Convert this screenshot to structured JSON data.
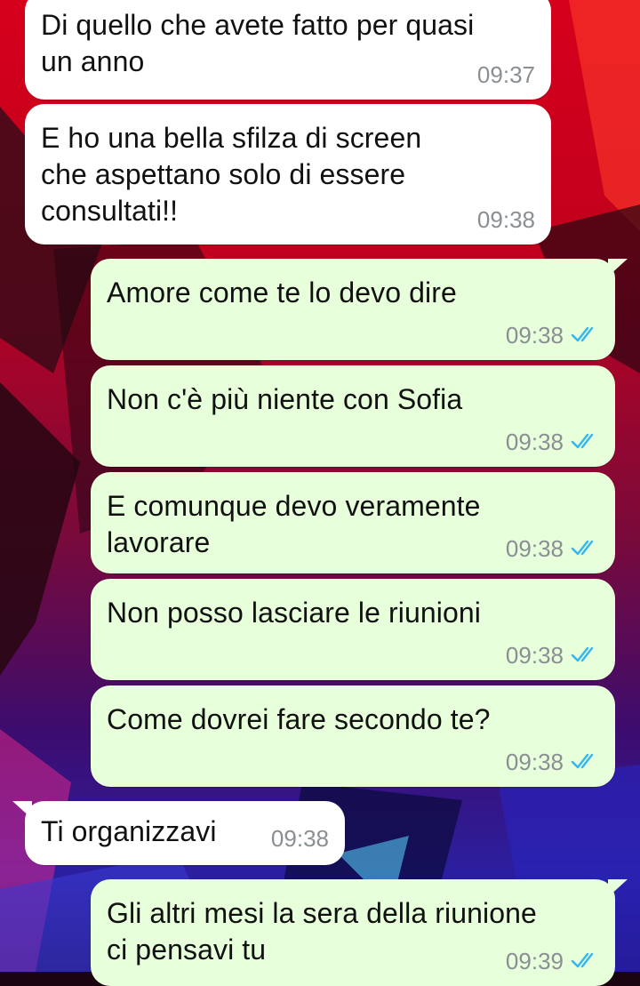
{
  "theme": {
    "incoming_bubble": "#ffffff",
    "outgoing_bubble": "#e7ffdb",
    "read_tick_color": "#34b7f1",
    "timestamp_color": "#8a8f93"
  },
  "messages": [
    {
      "direction": "in",
      "text": "Di quello che avete fatto per quasi\nun anno",
      "time": "09:37"
    },
    {
      "direction": "in",
      "text": "E ho una bella sfilza di screen\nche aspettano solo di essere\nconsultati!!",
      "time": "09:38"
    },
    {
      "direction": "out",
      "text": "Amore come te lo devo dire",
      "time": "09:38",
      "status": "read-double-tick-icon"
    },
    {
      "direction": "out",
      "text": "Non c'è più niente con Sofia",
      "time": "09:38",
      "status": "read-double-tick-icon"
    },
    {
      "direction": "out",
      "text": "E comunque devo veramente\nlavorare",
      "time": "09:38",
      "status": "read-double-tick-icon"
    },
    {
      "direction": "out",
      "text": "Non posso lasciare le riunioni",
      "time": "09:38",
      "status": "read-double-tick-icon"
    },
    {
      "direction": "out",
      "text": "Come dovrei fare secondo te?",
      "time": "09:38",
      "status": "read-double-tick-icon"
    },
    {
      "direction": "in",
      "text": "Ti organizzavi",
      "time": "09:38"
    },
    {
      "direction": "out",
      "text": "Gli altri mesi la sera della riunione\nci pensavi tu",
      "time": "09:39",
      "status": "read-double-tick-icon"
    }
  ]
}
